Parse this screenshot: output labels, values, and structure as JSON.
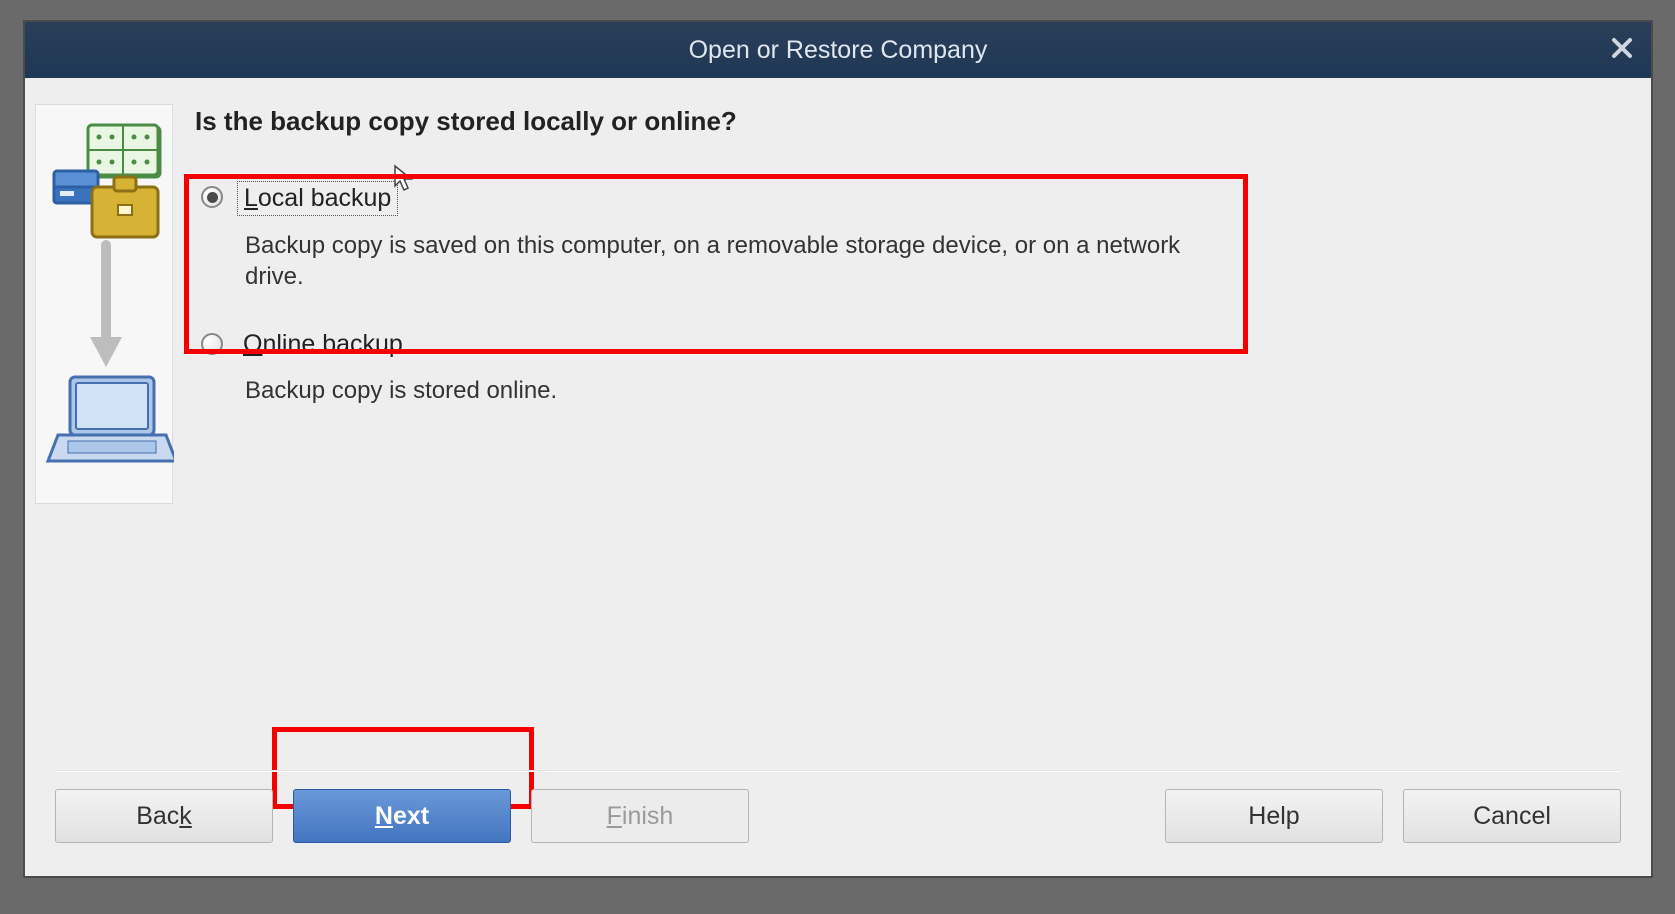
{
  "titlebar": {
    "title": "Open or Restore Company"
  },
  "content": {
    "heading": "Is the backup copy stored locally or online?",
    "options": [
      {
        "label_pre": "L",
        "label_rest": "ocal backup",
        "desc": "Backup copy is saved on this computer, on a removable storage device, or on a network drive.",
        "selected": true,
        "focused": true
      },
      {
        "label_pre": "O",
        "label_rest": "nline backup",
        "desc": "Backup copy is stored online.",
        "selected": false,
        "focused": false
      }
    ]
  },
  "footer": {
    "back_pre": "Bac",
    "back_ul": "k",
    "next_ul": "N",
    "next_rest": "ext",
    "finish_ul": "F",
    "finish_rest": "inish",
    "help": "Help",
    "cancel": "Cancel"
  },
  "annotations": {
    "highlighted_option_index": 0,
    "highlighted_button": "next"
  }
}
